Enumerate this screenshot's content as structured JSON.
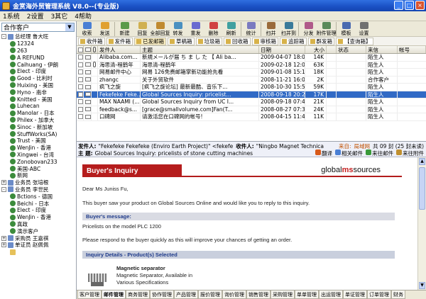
{
  "window": {
    "title": "金赏海外贸管理系统 V8.0--(专业版)",
    "buttons": [
      "_",
      "□",
      "×"
    ]
  },
  "menu": [
    "1系统",
    "2设置",
    "3其它",
    "4帮助"
  ],
  "sidebar": {
    "combo_value": "合作客户",
    "tree": [
      {
        "label": "总经理 鲁大旺",
        "level": 0,
        "kind": "grp",
        "expander": "-"
      },
      {
        "label": "12324",
        "level": 2,
        "kind": "node"
      },
      {
        "label": "263",
        "level": 2,
        "kind": "node"
      },
      {
        "label": "A REFUND",
        "level": 2,
        "kind": "node"
      },
      {
        "label": "Caihuang - 伊朗",
        "level": 2,
        "kind": "node"
      },
      {
        "label": "Elect - 印度",
        "level": 2,
        "kind": "node"
      },
      {
        "label": "Good - 比利时",
        "level": 2,
        "kind": "node"
      },
      {
        "label": "Huixing - 美国",
        "level": 2,
        "kind": "node"
      },
      {
        "label": "Hyno - 南非",
        "level": 2,
        "kind": "node"
      },
      {
        "label": "Knitted - 美国",
        "level": 2,
        "kind": "node"
      },
      {
        "label": "Luhecan",
        "level": 2,
        "kind": "node"
      },
      {
        "label": "Manolar - 日本",
        "level": 2,
        "kind": "node"
      },
      {
        "label": "Philex - 加拿大",
        "level": 2,
        "kind": "node"
      },
      {
        "label": "Sinoc - 新加坡",
        "level": 2,
        "kind": "node"
      },
      {
        "label": "StuffWorks(SA)",
        "level": 2,
        "kind": "node"
      },
      {
        "label": "Trust - 美国",
        "level": 2,
        "kind": "node"
      },
      {
        "label": "WenJin - 香港",
        "level": 2,
        "kind": "node"
      },
      {
        "label": "Xingwei - 台湾",
        "level": 2,
        "kind": "node"
      },
      {
        "label": "Zonobovan233",
        "level": 2,
        "kind": "node"
      },
      {
        "label": "美国-ABC",
        "level": 2,
        "kind": "node"
      },
      {
        "label": "新网",
        "level": 2,
        "kind": "node"
      },
      {
        "label": "业务员 张培根",
        "level": 0,
        "kind": "grp",
        "expander": "+"
      },
      {
        "label": "业务员 李世民",
        "level": 0,
        "kind": "grp",
        "expander": "-"
      },
      {
        "label": "Bctions - 德国",
        "level": 2,
        "kind": "node"
      },
      {
        "label": "Beichi - 日本",
        "level": 2,
        "kind": "node"
      },
      {
        "label": "Elect - 印度",
        "level": 2,
        "kind": "node"
      },
      {
        "label": "WenJin - 香港",
        "level": 2,
        "kind": "node"
      },
      {
        "label": "真政",
        "level": 2,
        "kind": "node"
      },
      {
        "label": "演示客户",
        "level": 2,
        "kind": "node"
      },
      {
        "label": "采购员 王嘉祺",
        "level": 0,
        "kind": "grp",
        "expander": "+"
      },
      {
        "label": "单证员 赵佩佩",
        "level": 0,
        "kind": "grp",
        "expander": "+"
      },
      {
        "label": "",
        "level": 2,
        "kind": "folder"
      }
    ]
  },
  "toolbar": [
    {
      "label": "收索",
      "color": "#4a7fd4"
    },
    {
      "label": "发送",
      "color": "#e0a030"
    },
    {
      "sep": true
    },
    {
      "label": "新建",
      "color": "#5a9a4a"
    },
    {
      "label": "回复",
      "color": "#d0b050"
    },
    {
      "label": "全部回复",
      "color": "#c08a30"
    },
    {
      "label": "转发",
      "color": "#4a90c0"
    },
    {
      "label": "重发",
      "color": "#6a6ad0"
    },
    {
      "label": "删除",
      "color": "#d04040"
    },
    {
      "label": "刷新",
      "color": "#40a0a0"
    },
    {
      "sep": true
    },
    {
      "label": "统计",
      "color": "#7a7ac0"
    },
    {
      "sep": true
    },
    {
      "label": "扫并",
      "color": "#9a6a3a"
    },
    {
      "label": "扫并到",
      "color": "#3a7a9a"
    },
    {
      "sep": true
    },
    {
      "label": "分发",
      "color": "#b05a8a"
    },
    {
      "label": "附件管理",
      "color": "#5a8a5a"
    },
    {
      "sep": true
    },
    {
      "label": "模板",
      "color": "#4a6ab0"
    },
    {
      "label": "设置",
      "color": "#707070"
    }
  ],
  "folders": [
    {
      "label": "收件箱",
      "active": false
    },
    {
      "label": "发件箱",
      "active": false
    },
    {
      "label": "已发邮箱",
      "active": true
    },
    {
      "label": "草稿箱",
      "active": false
    },
    {
      "label": "垃圾箱",
      "active": false
    },
    {
      "label": "回收箱",
      "active": false
    },
    {
      "label": "审核箱",
      "active": false
    },
    {
      "label": "追踪箱",
      "active": false
    },
    {
      "label": "群发箱",
      "active": false
    },
    {
      "label": "【查询箱】",
      "active": false
    }
  ],
  "grid": {
    "headers": {
      "from": "发件人",
      "subject": "主题",
      "date": "日期",
      "size": "大小",
      "status": "状态",
      "type": "来信",
      "account": "帐号"
    },
    "rows": [
      {
        "from": "Alibaba.com...",
        "subject": "新規メールが届 ち ま し た 【 Ali ba...",
        "date": "2009-04-07 18:03",
        "size": "14K",
        "status": "",
        "type": "陌生人",
        "account": "",
        "attach": false,
        "selected": false
      },
      {
        "from": "海思清-程鹤年",
        "subject": "海思清-程鹤年",
        "date": "2009-02-18 12:05",
        "size": "63K",
        "status": "",
        "type": "陌生人",
        "account": "",
        "attach": true,
        "selected": false
      },
      {
        "from": "网易邮件中心",
        "subject": "网易 126免费邮箱掌新功能抢先看",
        "date": "2009-01-08 15:10",
        "size": "18K",
        "status": "",
        "type": "陌生人",
        "account": "",
        "attach": false,
        "selected": false
      },
      {
        "from": "zhangc",
        "subject": "关于外贸软件",
        "date": "2008-11-21 16:09",
        "size": "2K",
        "status": "",
        "type": "合作客户",
        "account": "",
        "attach": false,
        "selected": false
      },
      {
        "from": "疯飞之旋",
        "subject": "[疯飞之旋论坛] 最新最酷、音乐下...",
        "date": "2008-10-30 15:59",
        "size": "59K",
        "status": "",
        "type": "陌生人",
        "account": "",
        "attach": false,
        "selected": false
      },
      {
        "from": "Fekefeke Feke...",
        "subject": "Global Sources Inquiry: pricelist...",
        "date": "2008-09-18 20:20",
        "size": "17K",
        "status": "",
        "type": "陌生人",
        "account": "",
        "attach": false,
        "selected": true
      },
      {
        "from": "MAX NAAMI (...",
        "subject": "Global Sources Inquiry from UC I...",
        "date": "2008-09-18 07:44",
        "size": "21K",
        "status": "",
        "type": "陌生人",
        "account": "",
        "attach": false,
        "selected": false
      },
      {
        "from": "feedback@s...",
        "subject": "[grace@smallvolume.com]Fan(T...",
        "date": "2008-08-27 07:35",
        "size": "24K",
        "status": "",
        "type": "陌生人",
        "account": "",
        "attach": false,
        "selected": false
      },
      {
        "from": "口碑网",
        "subject": "请激活您在口碑网的帐号!",
        "date": "2008-04-15 11:47",
        "size": "11K",
        "status": "",
        "type": "陌生人",
        "account": "",
        "attach": false,
        "selected": false
      }
    ]
  },
  "preview_header": {
    "from_label": "发件人:",
    "from_value": "\"Fekefeke Fekefeke (Enviro Earth Project)\" <fekefe",
    "to_label": "收件人:",
    "to_value": "\"Ningbo Magnet Technica",
    "subject_label": "主  题:",
    "subject_value": "Global Sources Inquiry: pricelists of stone cutting machines",
    "source_label": "来自:",
    "source_value": "局域网",
    "count_text": "共 09 封 (25 封未读)",
    "actions": [
      "翻译",
      "相关邮件",
      "来往邮件",
      "来往附件"
    ]
  },
  "preview": {
    "banner_title": "Buyer's Inquiry",
    "logo_global": "global",
    "logo_ms": "ms",
    "logo_sources": "sources",
    "greeting": "Dear Ms Juniss Fu,",
    "intro": "This buyer saw your product on Global Sources Online and would like you to reply to this inquiry.",
    "buyers_message_head": "Buyer's message:",
    "buyers_message": "Pricelists on the model PLC 1200",
    "respond": "Please respond to the buyer quickly as this will improve your chances of getting an order.",
    "inquiry_head": "Inquiry Details - Product(s) Selected",
    "product_name": "Magnetic separator",
    "product_line1": "Magnetic Separator, Available in",
    "product_line2": "Various Specifications"
  },
  "bottom_tabs": [
    {
      "label": "客户管理",
      "active": false
    },
    {
      "label": "邮件管理",
      "active": true
    },
    {
      "label": "商务管理",
      "active": false
    },
    {
      "label": "协作管理",
      "active": false
    },
    {
      "label": "产品管理",
      "active": false
    },
    {
      "label": "报价管理",
      "active": false
    },
    {
      "label": "询价管理",
      "active": false
    },
    {
      "label": "销售管理",
      "active": false
    },
    {
      "label": "采购管理",
      "active": false
    },
    {
      "label": "单单管理",
      "active": false
    },
    {
      "label": "出运管理",
      "active": false
    },
    {
      "label": "单证管理",
      "active": false
    },
    {
      "label": "订单管理",
      "active": false
    },
    {
      "label": "财务",
      "active": false
    }
  ]
}
